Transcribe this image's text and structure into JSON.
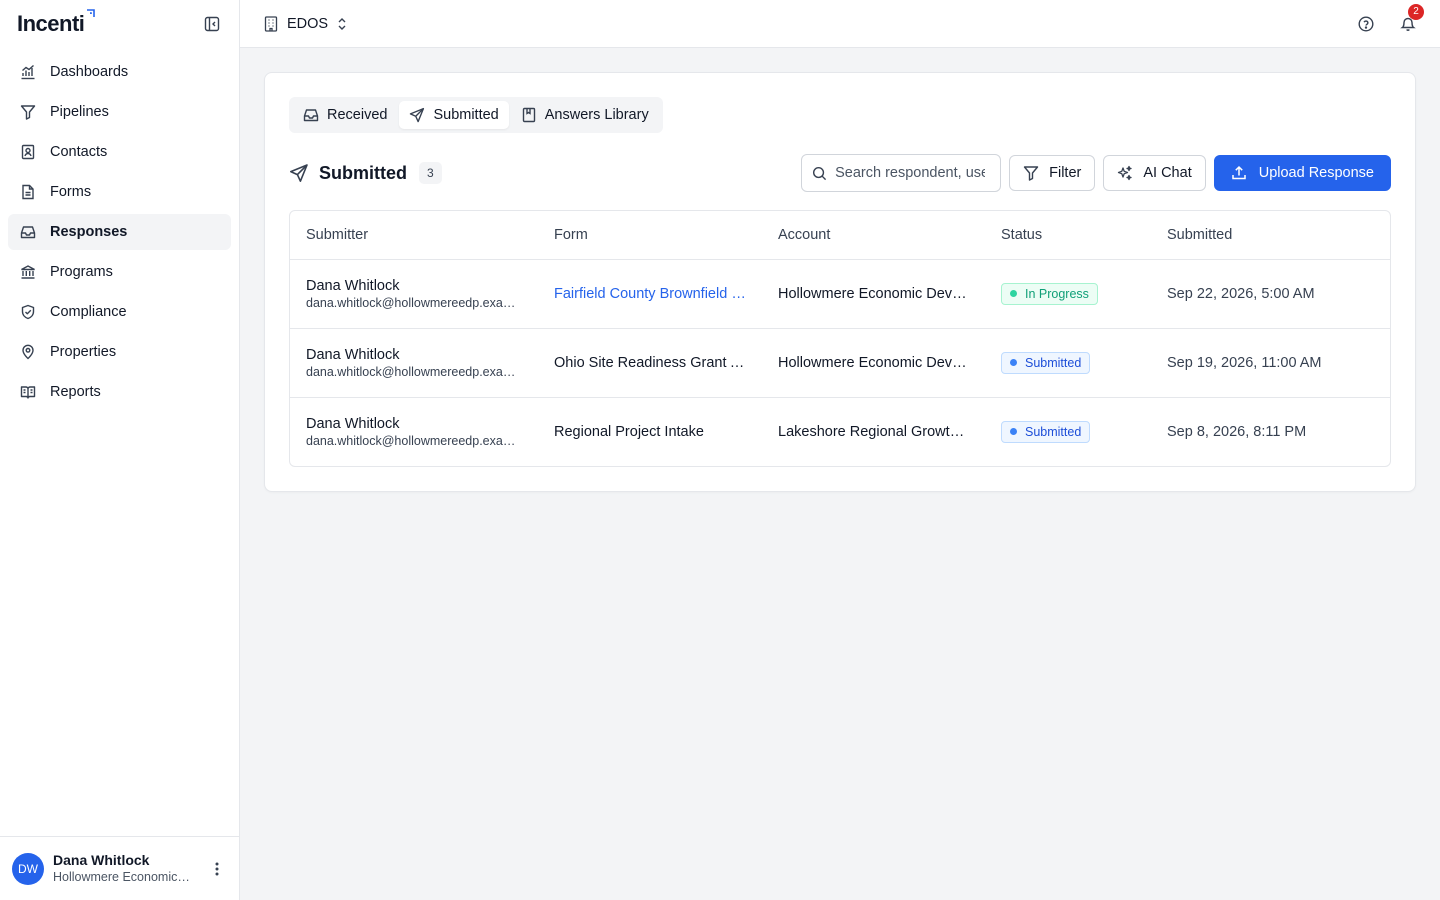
{
  "brand": {
    "name": "Incenti"
  },
  "sidebar": {
    "items": [
      {
        "label": "Dashboards",
        "icon": "chart-icon",
        "active": false
      },
      {
        "label": "Pipelines",
        "icon": "filter-icon",
        "active": false
      },
      {
        "label": "Contacts",
        "icon": "contact-book-icon",
        "active": false
      },
      {
        "label": "Forms",
        "icon": "document-icon",
        "active": false
      },
      {
        "label": "Responses",
        "icon": "inbox-icon",
        "active": true
      },
      {
        "label": "Programs",
        "icon": "bank-icon",
        "active": false
      },
      {
        "label": "Compliance",
        "icon": "shield-check-icon",
        "active": false
      },
      {
        "label": "Properties",
        "icon": "map-pin-icon",
        "active": false
      },
      {
        "label": "Reports",
        "icon": "book-open-icon",
        "active": false
      }
    ],
    "user": {
      "initials": "DW",
      "name": "Dana Whitlock",
      "org": "Hollowmere Economic Development Partnership"
    }
  },
  "topbar": {
    "org_name": "EDOS",
    "notification_count": "2"
  },
  "tabs": [
    {
      "label": "Received",
      "active": false
    },
    {
      "label": "Submitted",
      "active": true
    },
    {
      "label": "Answers Library",
      "active": false
    }
  ],
  "list": {
    "title": "Submitted",
    "count": "3",
    "search_placeholder": "Search respondent, user, form...",
    "filter_label": "Filter",
    "ai_chat_label": "AI Chat",
    "upload_label": "Upload Response"
  },
  "table": {
    "columns": [
      "Submitter",
      "Form",
      "Account",
      "Status",
      "Submitted"
    ],
    "rows": [
      {
        "name": "Dana Whitlock",
        "email": "dana.whitlock@hollowmereedp.example.com",
        "form": "Fairfield County Brownfield Redevelopment Application",
        "form_link": true,
        "account": "Hollowmere Economic Development Partnership",
        "status": "In Progress",
        "status_kind": "progress",
        "submitted": "Sep 22, 2026, 5:00 AM"
      },
      {
        "name": "Dana Whitlock",
        "email": "dana.whitlock@hollowmereedp.example.com",
        "form": "Ohio Site Readiness Grant Application",
        "form_link": false,
        "account": "Hollowmere Economic Development Partnership",
        "status": "Submitted",
        "status_kind": "submitted",
        "submitted": "Sep 19, 2026, 11:00 AM"
      },
      {
        "name": "Dana Whitlock",
        "email": "dana.whitlock@hollowmereedp.example.com",
        "form": "Regional Project Intake",
        "form_link": false,
        "account": "Lakeshore Regional Growth Alliance",
        "status": "Submitted",
        "status_kind": "submitted",
        "submitted": "Sep 8, 2026, 8:11 PM"
      }
    ]
  },
  "colors": {
    "primary": "#2563eb",
    "in_progress": "#0f9f77",
    "submitted": "#1d4ed8",
    "badge": "#dc2626"
  }
}
